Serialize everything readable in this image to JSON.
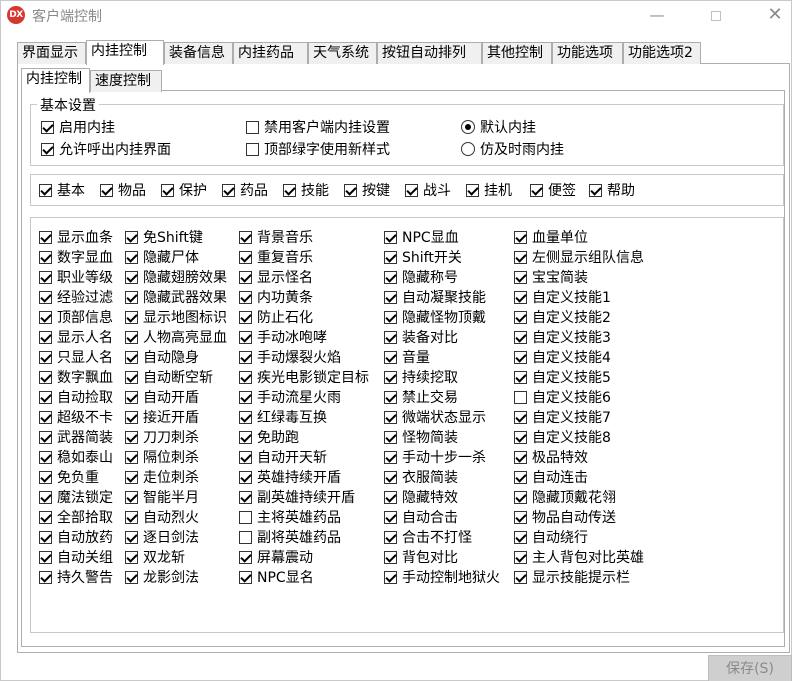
{
  "window": {
    "title": "客户端控制",
    "icon_text": "DX",
    "minimize": "—",
    "close": "✕"
  },
  "tabs": [
    {
      "label": "界面显示",
      "active": false
    },
    {
      "label": "内挂控制",
      "active": true
    },
    {
      "label": "装备信息",
      "active": false
    },
    {
      "label": "内挂药品",
      "active": false
    },
    {
      "label": "天气系统",
      "active": false
    },
    {
      "label": "按钮自动排列",
      "active": false
    },
    {
      "label": "其他控制",
      "active": false
    },
    {
      "label": "功能选项",
      "active": false
    },
    {
      "label": "功能选项2",
      "active": false
    }
  ],
  "subtabs": [
    {
      "label": "内挂控制",
      "active": true
    },
    {
      "label": "速度控制",
      "active": false
    }
  ],
  "basic": {
    "title": "基本设置",
    "options": [
      {
        "label": "启用内挂",
        "type": "check",
        "checked": true
      },
      {
        "label": "允许呼出内挂界面",
        "type": "check",
        "checked": true
      },
      {
        "label": "禁用客户端内挂设置",
        "type": "check",
        "checked": false
      },
      {
        "label": "顶部绿字使用新样式",
        "type": "check",
        "checked": false
      },
      {
        "label": "默认内挂",
        "type": "radio",
        "checked": true
      },
      {
        "label": "仿及时雨内挂",
        "type": "radio",
        "checked": false
      }
    ]
  },
  "categories": [
    {
      "label": "基本",
      "checked": true
    },
    {
      "label": "物品",
      "checked": true
    },
    {
      "label": "保护",
      "checked": true
    },
    {
      "label": "药品",
      "checked": true
    },
    {
      "label": "技能",
      "checked": true
    },
    {
      "label": "按键",
      "checked": true
    },
    {
      "label": "战斗",
      "checked": true
    },
    {
      "label": "挂机",
      "checked": true
    },
    {
      "label": "便签",
      "checked": true
    },
    {
      "label": "帮助",
      "checked": true
    }
  ],
  "columns": [
    [
      {
        "label": "显示血条",
        "checked": true
      },
      {
        "label": "数字显血",
        "checked": true
      },
      {
        "label": "职业等级",
        "checked": true
      },
      {
        "label": "经验过滤",
        "checked": true
      },
      {
        "label": "顶部信息",
        "checked": true
      },
      {
        "label": "显示人名",
        "checked": true
      },
      {
        "label": "只显人名",
        "checked": true
      },
      {
        "label": "数字飘血",
        "checked": true
      },
      {
        "label": "自动捡取",
        "checked": true
      },
      {
        "label": "超级不卡",
        "checked": true
      },
      {
        "label": "武器简装",
        "checked": true
      },
      {
        "label": "稳如泰山",
        "checked": true
      },
      {
        "label": "免负重",
        "checked": true
      },
      {
        "label": "魔法锁定",
        "checked": true
      },
      {
        "label": "全部拾取",
        "checked": true
      },
      {
        "label": "自动放药",
        "checked": true
      },
      {
        "label": "自动关组",
        "checked": true
      },
      {
        "label": "持久警告",
        "checked": true
      }
    ],
    [
      {
        "label": "免Shift键",
        "checked": true
      },
      {
        "label": "隐藏尸体",
        "checked": true
      },
      {
        "label": "隐藏翅膀效果",
        "checked": true
      },
      {
        "label": "隐藏武器效果",
        "checked": true
      },
      {
        "label": "显示地图标识",
        "checked": true
      },
      {
        "label": "人物高亮显血",
        "checked": true
      },
      {
        "label": "自动隐身",
        "checked": true
      },
      {
        "label": "自动断空斩",
        "checked": true
      },
      {
        "label": "自动开盾",
        "checked": true
      },
      {
        "label": "接近开盾",
        "checked": true
      },
      {
        "label": "刀刀刺杀",
        "checked": true
      },
      {
        "label": "隔位刺杀",
        "checked": true
      },
      {
        "label": "走位刺杀",
        "checked": true
      },
      {
        "label": "智能半月",
        "checked": true
      },
      {
        "label": "自动烈火",
        "checked": true
      },
      {
        "label": "逐日剑法",
        "checked": true
      },
      {
        "label": "双龙斩",
        "checked": true
      },
      {
        "label": "龙影剑法",
        "checked": true
      }
    ],
    [
      {
        "label": "背景音乐",
        "checked": true
      },
      {
        "label": "重复音乐",
        "checked": true
      },
      {
        "label": "显示怪名",
        "checked": true
      },
      {
        "label": "内功黄条",
        "checked": true
      },
      {
        "label": "防止石化",
        "checked": true
      },
      {
        "label": "手动冰咆哮",
        "checked": true
      },
      {
        "label": "手动爆裂火焰",
        "checked": true
      },
      {
        "label": "疾光电影锁定目标",
        "checked": true
      },
      {
        "label": "手动流星火雨",
        "checked": true
      },
      {
        "label": "红绿毒互换",
        "checked": true
      },
      {
        "label": "免助跑",
        "checked": true
      },
      {
        "label": "自动开天斩",
        "checked": true
      },
      {
        "label": "英雄持续开盾",
        "checked": true
      },
      {
        "label": "副英雄持续开盾",
        "checked": true
      },
      {
        "label": "主将英雄药品",
        "checked": false
      },
      {
        "label": "副将英雄药品",
        "checked": false
      },
      {
        "label": "屏幕震动",
        "checked": true
      },
      {
        "label": "NPC显名",
        "checked": true
      }
    ],
    [
      {
        "label": "NPC显血",
        "checked": true
      },
      {
        "label": "Shift开关",
        "checked": true
      },
      {
        "label": "隐藏称号",
        "checked": true
      },
      {
        "label": "自动凝聚技能",
        "checked": true
      },
      {
        "label": "隐藏怪物顶戴",
        "checked": true
      },
      {
        "label": "装备对比",
        "checked": true
      },
      {
        "label": "音量",
        "checked": true
      },
      {
        "label": "持续挖取",
        "checked": true
      },
      {
        "label": "禁止交易",
        "checked": true
      },
      {
        "label": "微端状态显示",
        "checked": true
      },
      {
        "label": "怪物简装",
        "checked": true
      },
      {
        "label": "手动十步一杀",
        "checked": true
      },
      {
        "label": "衣服简装",
        "checked": true
      },
      {
        "label": "隐藏特效",
        "checked": true
      },
      {
        "label": "自动合击",
        "checked": true
      },
      {
        "label": "合击不打怪",
        "checked": true
      },
      {
        "label": "背包对比",
        "checked": true
      },
      {
        "label": "手动控制地狱火",
        "checked": true
      }
    ],
    [
      {
        "label": "血量单位",
        "checked": true
      },
      {
        "label": "左侧显示组队信息",
        "checked": true
      },
      {
        "label": "宝宝简装",
        "checked": true
      },
      {
        "label": "自定义技能1",
        "checked": true
      },
      {
        "label": "自定义技能2",
        "checked": true
      },
      {
        "label": "自定义技能3",
        "checked": true
      },
      {
        "label": "自定义技能4",
        "checked": true
      },
      {
        "label": "自定义技能5",
        "checked": true
      },
      {
        "label": "自定义技能6",
        "checked": false
      },
      {
        "label": "自定义技能7",
        "checked": true
      },
      {
        "label": "自定义技能8",
        "checked": true
      },
      {
        "label": "极品特效",
        "checked": true
      },
      {
        "label": "自动连击",
        "checked": true
      },
      {
        "label": "隐藏顶戴花翎",
        "checked": true
      },
      {
        "label": "物品自动传送",
        "checked": true
      },
      {
        "label": "自动绕行",
        "checked": true
      },
      {
        "label": "主人背包对比英雄",
        "checked": true
      },
      {
        "label": "显示技能提示栏",
        "checked": true
      }
    ]
  ],
  "save_button": "保存(S)"
}
